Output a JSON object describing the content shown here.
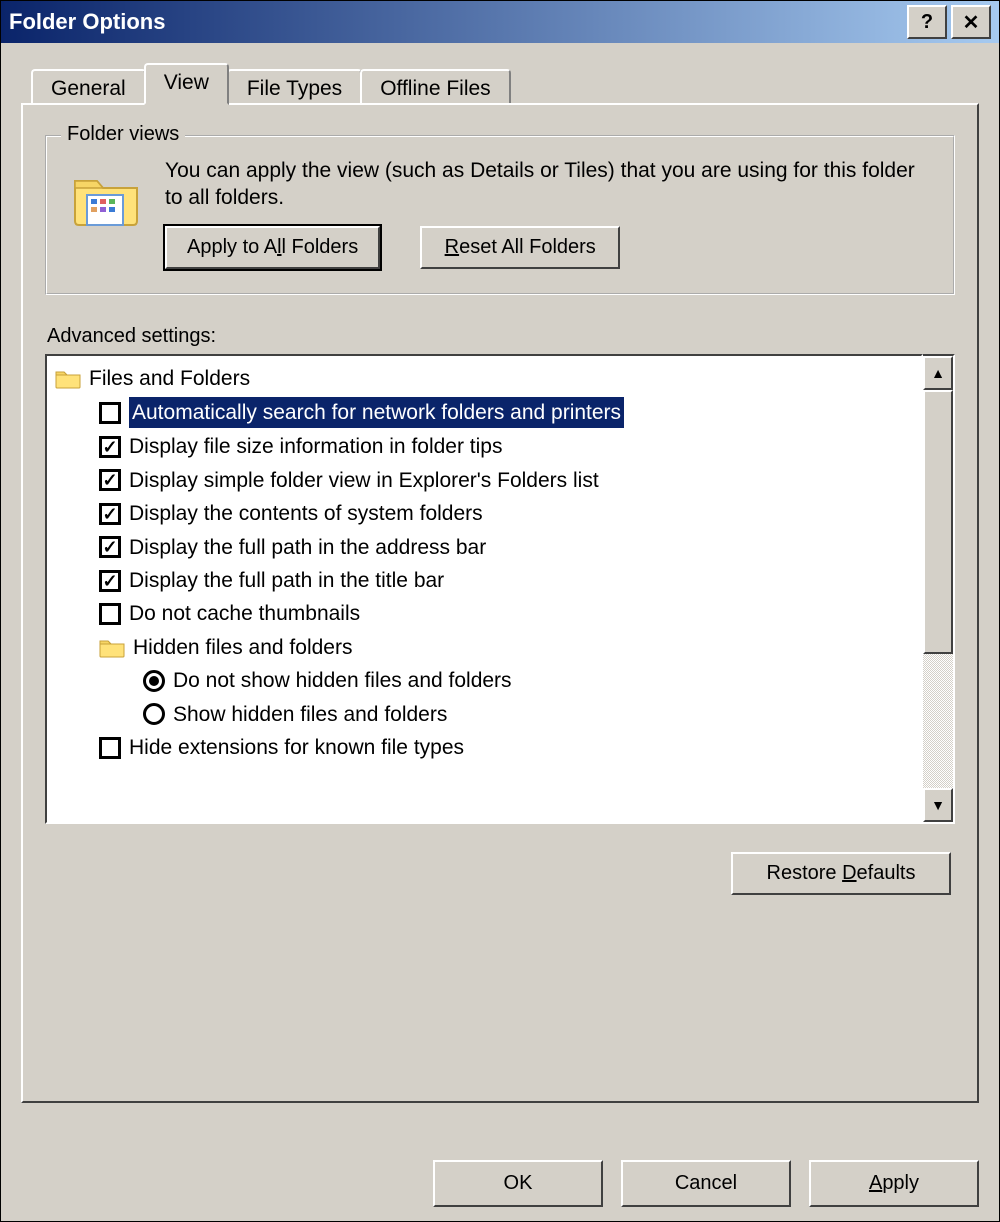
{
  "title": "Folder Options",
  "tabs": {
    "general": "General",
    "view": "View",
    "filetypes": "File Types",
    "offlinefiles": "Offline Files"
  },
  "folderviews": {
    "legend": "Folder views",
    "desc": "You can apply the view (such as Details or Tiles) that you are using for this folder to all folders.",
    "apply_prefix": "Apply to A",
    "apply_u": "l",
    "apply_suffix": "l Folders",
    "reset_u": "R",
    "reset_suffix": "eset All Folders"
  },
  "advanced": {
    "label": "Advanced settings:",
    "group_files": "Files and Folders",
    "items": {
      "i0": "Automatically search for network folders and printers",
      "i1": "Display file size information in folder tips",
      "i2": "Display simple folder view in Explorer's Folders list",
      "i3": "Display the contents of system folders",
      "i4": "Display the full path in the address bar",
      "i5": "Display the full path in the title bar",
      "i6": "Do not cache thumbnails",
      "hidden_group": "Hidden files and folders",
      "r0": "Do not show hidden files and folders",
      "r1": "Show hidden files and folders",
      "i7": "Hide extensions for known file types"
    }
  },
  "restore_prefix": "Restore ",
  "restore_u": "D",
  "restore_suffix": "efaults",
  "buttons": {
    "ok": "OK",
    "cancel": "Cancel",
    "apply_u": "A",
    "apply_suffix": "pply"
  }
}
